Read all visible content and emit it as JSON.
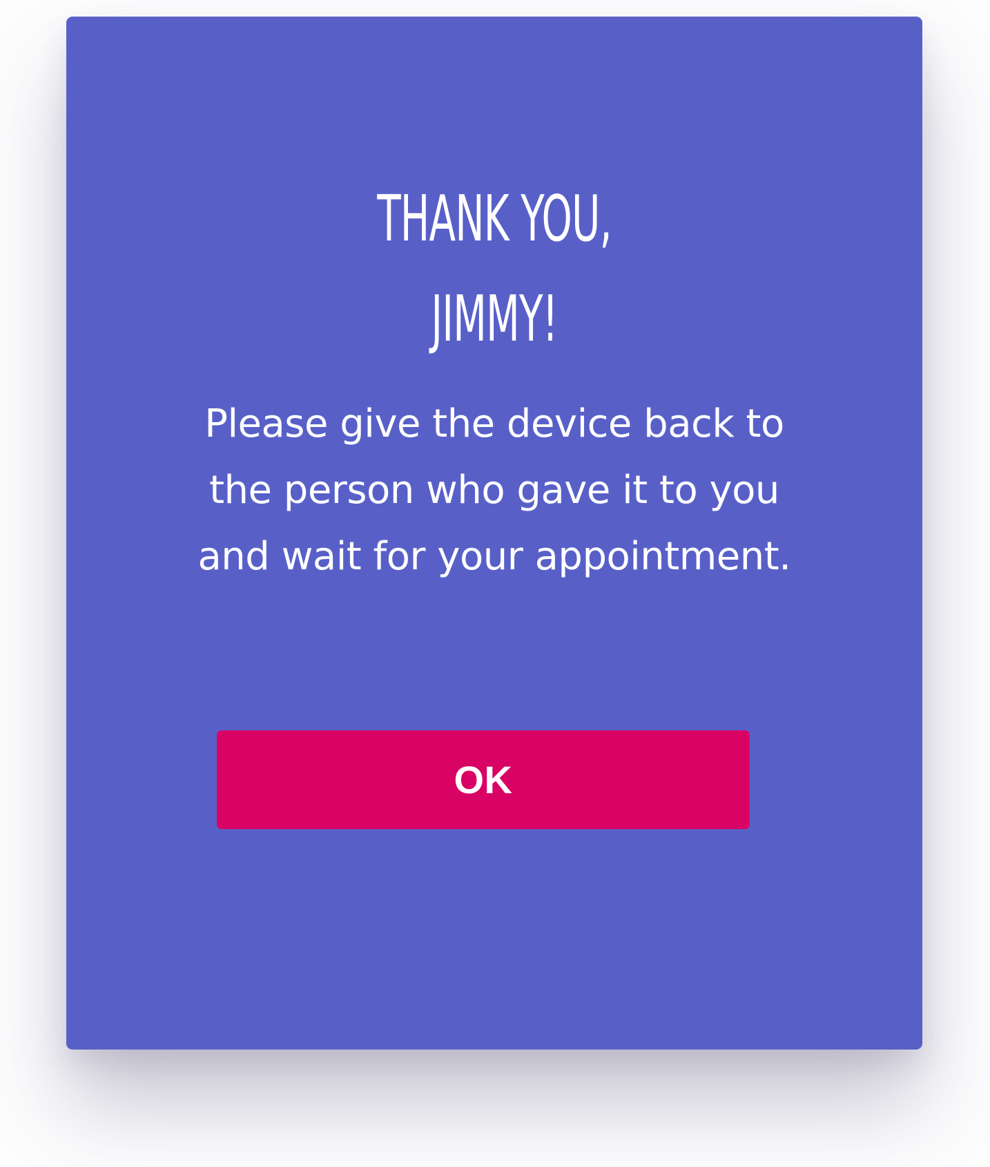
{
  "dialog": {
    "title": "Thank you,\nJimmy!",
    "message": "Please give the device back to\nthe person who gave it to you\nand wait for your appointment.",
    "ok_label": "OK"
  },
  "colors": {
    "card_background": "#5860C8",
    "button_background": "#D80365",
    "text": "#FFFFFF"
  }
}
